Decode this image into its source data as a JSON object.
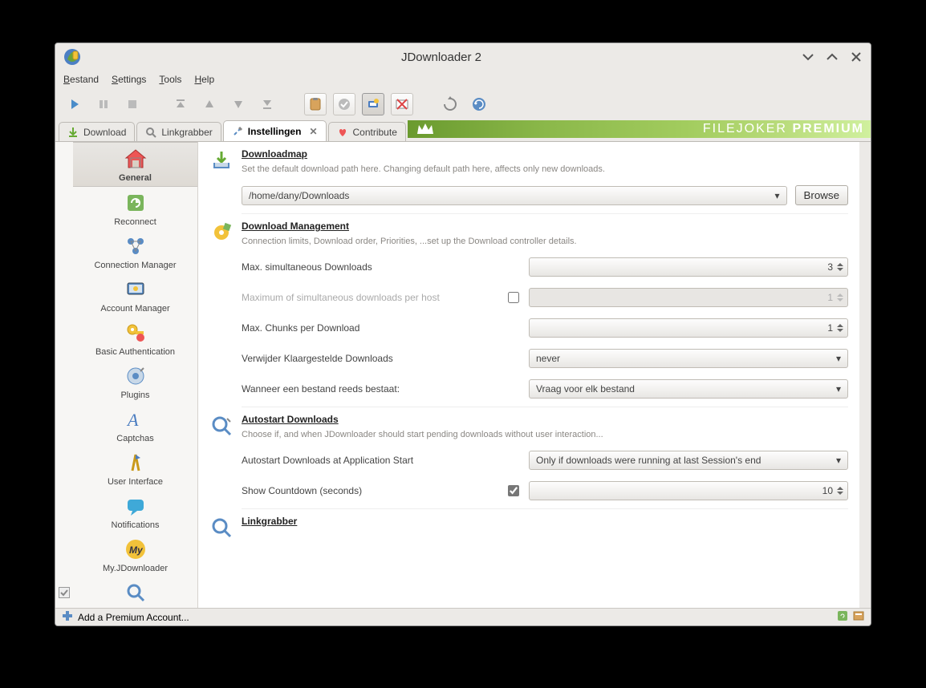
{
  "window": {
    "title": "JDownloader 2"
  },
  "menu": {
    "file": "Bestand",
    "settings": "Settings",
    "tools": "Tools",
    "help": "Help"
  },
  "tabs": {
    "download": "Download",
    "linkgrabber": "Linkgrabber",
    "settings": "Instellingen",
    "contribute": "Contribute"
  },
  "banner": {
    "brand": "FILEJOKER",
    "premium": "PREMIUM"
  },
  "sidebar": [
    {
      "label": "General"
    },
    {
      "label": "Reconnect"
    },
    {
      "label": "Connection Manager"
    },
    {
      "label": "Account Manager"
    },
    {
      "label": "Basic Authentication"
    },
    {
      "label": "Plugins"
    },
    {
      "label": "Captchas"
    },
    {
      "label": "User Interface"
    },
    {
      "label": "Notifications"
    },
    {
      "label": "My.JDownloader"
    }
  ],
  "sections": {
    "downloadmap": {
      "title": "Downloadmap",
      "desc": "Set the default download path here. Changing default path here, affects only new downloads.",
      "path": "/home/dany/Downloads",
      "browse": "Browse"
    },
    "dlmanagement": {
      "title": "Download Management",
      "desc": "Connection limits, Download order, Priorities, ...set up the Download controller details.",
      "max_sim_label": "Max. simultaneous Downloads",
      "max_sim_value": "3",
      "max_host_label": "Maximum of simultaneous downloads per host",
      "max_host_value": "1",
      "max_chunks_label": "Max. Chunks per Download",
      "max_chunks_value": "1",
      "remove_finished_label": "Verwijder Klaargestelde Downloads",
      "remove_finished_value": "never",
      "file_exists_label": "Wanneer een bestand reeds bestaat:",
      "file_exists_value": "Vraag voor elk bestand"
    },
    "autostart": {
      "title": "Autostart Downloads",
      "desc": "Choose if, and when JDownloader should start pending downloads without user interaction...",
      "at_start_label": "Autostart Downloads at Application Start",
      "at_start_value": "Only if downloads were running at last Session's end",
      "countdown_label": "Show Countdown (seconds)",
      "countdown_value": "10"
    },
    "linkgrabber": {
      "title": "Linkgrabber"
    }
  },
  "statusbar": {
    "add_premium": "Add a Premium Account..."
  }
}
